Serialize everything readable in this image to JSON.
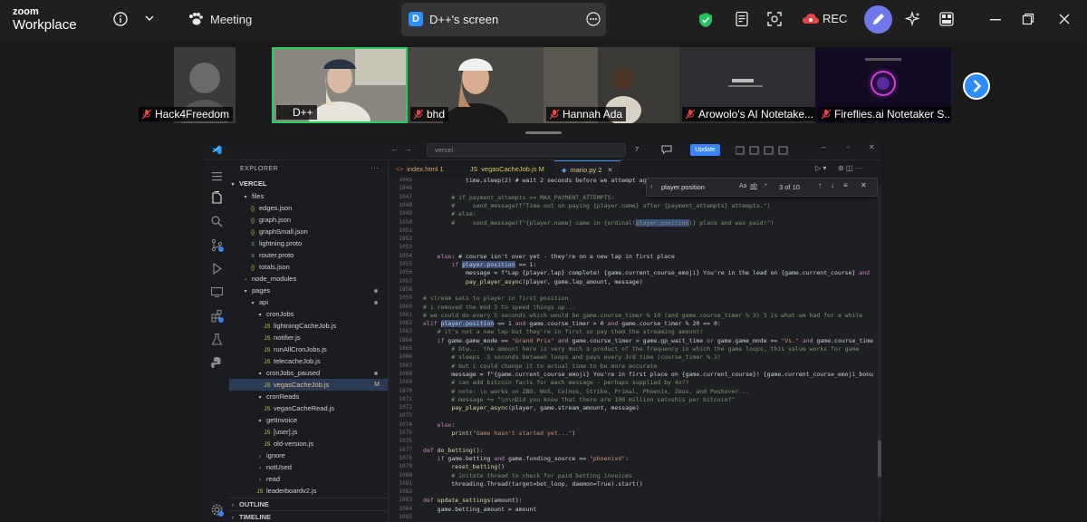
{
  "zoom": {
    "brand_top": "zoom",
    "brand_bottom": "Workplace",
    "meeting_label": "Meeting",
    "share_badge": "D",
    "share_title": "D++'s screen",
    "rec_label": "REC"
  },
  "participants": [
    {
      "name": "Hack4Freedom"
    },
    {
      "name": "D++"
    },
    {
      "name": "bhd"
    },
    {
      "name": "Hannah Ada"
    },
    {
      "name": "Arowolo's AI Notetake..."
    },
    {
      "name": "Fireflies.ai Notetaker S..."
    }
  ],
  "colors": {
    "accent": "#2d8cff",
    "active_speaker": "#23d160",
    "shield": "#21c55d",
    "rec": "#e84545"
  },
  "vscode": {
    "search_text": "vercel",
    "badge_count": "7",
    "update_label": "Update",
    "explorer_label": "EXPLORER",
    "root_label": "VERCEL",
    "tree": [
      {
        "label": "files",
        "type": "folder-open"
      },
      {
        "label": "edges.json",
        "type": "json"
      },
      {
        "label": "graph.json",
        "type": "json"
      },
      {
        "label": "graphSmall.json",
        "type": "json"
      },
      {
        "label": "lightning.proto",
        "type": "file"
      },
      {
        "label": "router.proto",
        "type": "file"
      },
      {
        "label": "totals.json",
        "type": "json"
      },
      {
        "label": "node_modules",
        "type": "folder"
      },
      {
        "label": "pages",
        "type": "folder-open"
      },
      {
        "label": "api",
        "type": "folder-open"
      },
      {
        "label": "cronJobs",
        "type": "folder-open"
      },
      {
        "label": "lightningCacheJob.js",
        "type": "js"
      },
      {
        "label": "notifier.js",
        "type": "js"
      },
      {
        "label": "runAllCronJobs.js",
        "type": "js"
      },
      {
        "label": "telecacheJob.js",
        "type": "js"
      },
      {
        "label": "cronJobs_paused",
        "type": "folder-open"
      },
      {
        "label": "vegasCacheJob.js",
        "type": "js",
        "status": "M"
      },
      {
        "label": "cronReads",
        "type": "folder-open"
      },
      {
        "label": "vegasCacheRead.js",
        "type": "js"
      },
      {
        "label": "getInvoice",
        "type": "folder-open"
      },
      {
        "label": "[user].js",
        "type": "js"
      },
      {
        "label": "old-version.js",
        "type": "js"
      },
      {
        "label": "ignore",
        "type": "folder"
      },
      {
        "label": "notUsed",
        "type": "folder"
      },
      {
        "label": "read",
        "type": "folder"
      },
      {
        "label": "leaderboardv2.js",
        "type": "js"
      }
    ],
    "outline_label": "OUTLINE",
    "timeline_label": "TIMELINE",
    "tabs": [
      {
        "label": "index.html 1"
      },
      {
        "label": "vegasCacheJob.js M"
      },
      {
        "label": "mario.py 2"
      }
    ],
    "find": {
      "query": "player.position",
      "count": "3 of 10",
      "opt_case": "Aa",
      "opt_word": "ab",
      "opt_regex": ".*"
    },
    "lines": [
      {
        "n": "1045",
        "t": "            time.sleep(2) # wait 2 seconds before we attempt again"
      },
      {
        "n": "1046",
        "t": ""
      },
      {
        "n": "1047",
        "t": "        # if payment_attempts >= MAX_PAYMENT_ATTEMPTS:"
      },
      {
        "n": "1048",
        "t": "        #     send_message(f\"Time out on paying {player.name} after {payment_attempts} attempts.\")"
      },
      {
        "n": "1049",
        "t": "        # else:"
      },
      {
        "n": "1050",
        "t": "        #     send_message(f\"{player.name} came in {ordinal(player.position)} place and was paid!\")"
      },
      {
        "n": "1051",
        "t": ""
      },
      {
        "n": "1052",
        "t": ""
      },
      {
        "n": "1053",
        "t": ""
      },
      {
        "n": "1054",
        "t": "    else: # course isn't over yet - they're on a new lap in first place"
      },
      {
        "n": "1055",
        "t": "        if player.position == 1:"
      },
      {
        "n": "1056",
        "t": "            message = f\"Lap {player.lap} complete! {game.current_course_emoji} You're in the lead on {game.current_course} and"
      },
      {
        "n": "1057",
        "t": "            pay_player_async(player, game.lap_amount, message)"
      },
      {
        "n": "1058",
        "t": ""
      },
      {
        "n": "1059",
        "t": "# stream sats to player in first position"
      },
      {
        "n": "1060",
        "t": "# i removed the mod 3 to speed things up..."
      },
      {
        "n": "1061",
        "t": "# we could do every 5 seconds which would be game.course_timer % 10 (and game.course_timer % 3) 3 is what we had for a while"
      },
      {
        "n": "1062",
        "t": "elif player.position == 1 and game.course_timer > 0 and game.course_timer % 20 == 0:"
      },
      {
        "n": "1063",
        "t": "    # it's not a new lap but they're in first so pay them the streaming amount!"
      },
      {
        "n": "1064",
        "t": "    if game.game_mode == \"Grand Prix\" and game.course_timer > game.gp_wait_time or game.game_mode == \"Vs.\" and game.course_time"
      },
      {
        "n": "1065",
        "t": "        # btw... the amount here is very much a product of the frequency in which the game loops, this value works for game"
      },
      {
        "n": "1066",
        "t": "        # sleeps .5 seconds between loops and pays every 3rd time (course_timer % 3)"
      },
      {
        "n": "1067",
        "t": "        # but i could change it to actual time to be more accurate"
      },
      {
        "n": "1068",
        "t": "        message = f\"{game.current_course_emoji} You're in first place on {game.current_course}! {game.current_course_emoji_bonu"
      },
      {
        "n": "1069",
        "t": "        # can add bitcoin facts for each message - perhaps supplied by 4o??"
      },
      {
        "n": "1070",
        "t": "        # note: \\n works on ZBD, WoS, Coinos, Strike, Primal, Phoenix, Zeus, and Pwshover..."
      },
      {
        "n": "1071",
        "t": "        # message += \"\\n\\nDid you know that there are 100 million satoshis per bitcoin?\""
      },
      {
        "n": "1072",
        "t": "        pay_player_async(player, game.stream_amount, message)"
      },
      {
        "n": "1073",
        "t": ""
      },
      {
        "n": "1074",
        "t": "    else:"
      },
      {
        "n": "1075",
        "t": "        print(\"Game hasn't started yet...\")"
      },
      {
        "n": "1076",
        "t": ""
      },
      {
        "n": "1077",
        "t": "def do_betting():"
      },
      {
        "n": "1078",
        "t": "    if game.betting and game.funding_source == \"phoenixd\":"
      },
      {
        "n": "1079",
        "t": "        reset_betting()"
      },
      {
        "n": "1080",
        "t": "        # initate thread to check for paid betting invoices"
      },
      {
        "n": "1081",
        "t": "        threading.Thread(target=bet_loop, daemon=True).start()"
      },
      {
        "n": "1082",
        "t": ""
      },
      {
        "n": "1083",
        "t": "def update_settings(amount):"
      },
      {
        "n": "1084",
        "t": "    game.betting_amount = amount"
      },
      {
        "n": "1085",
        "t": ""
      }
    ]
  }
}
